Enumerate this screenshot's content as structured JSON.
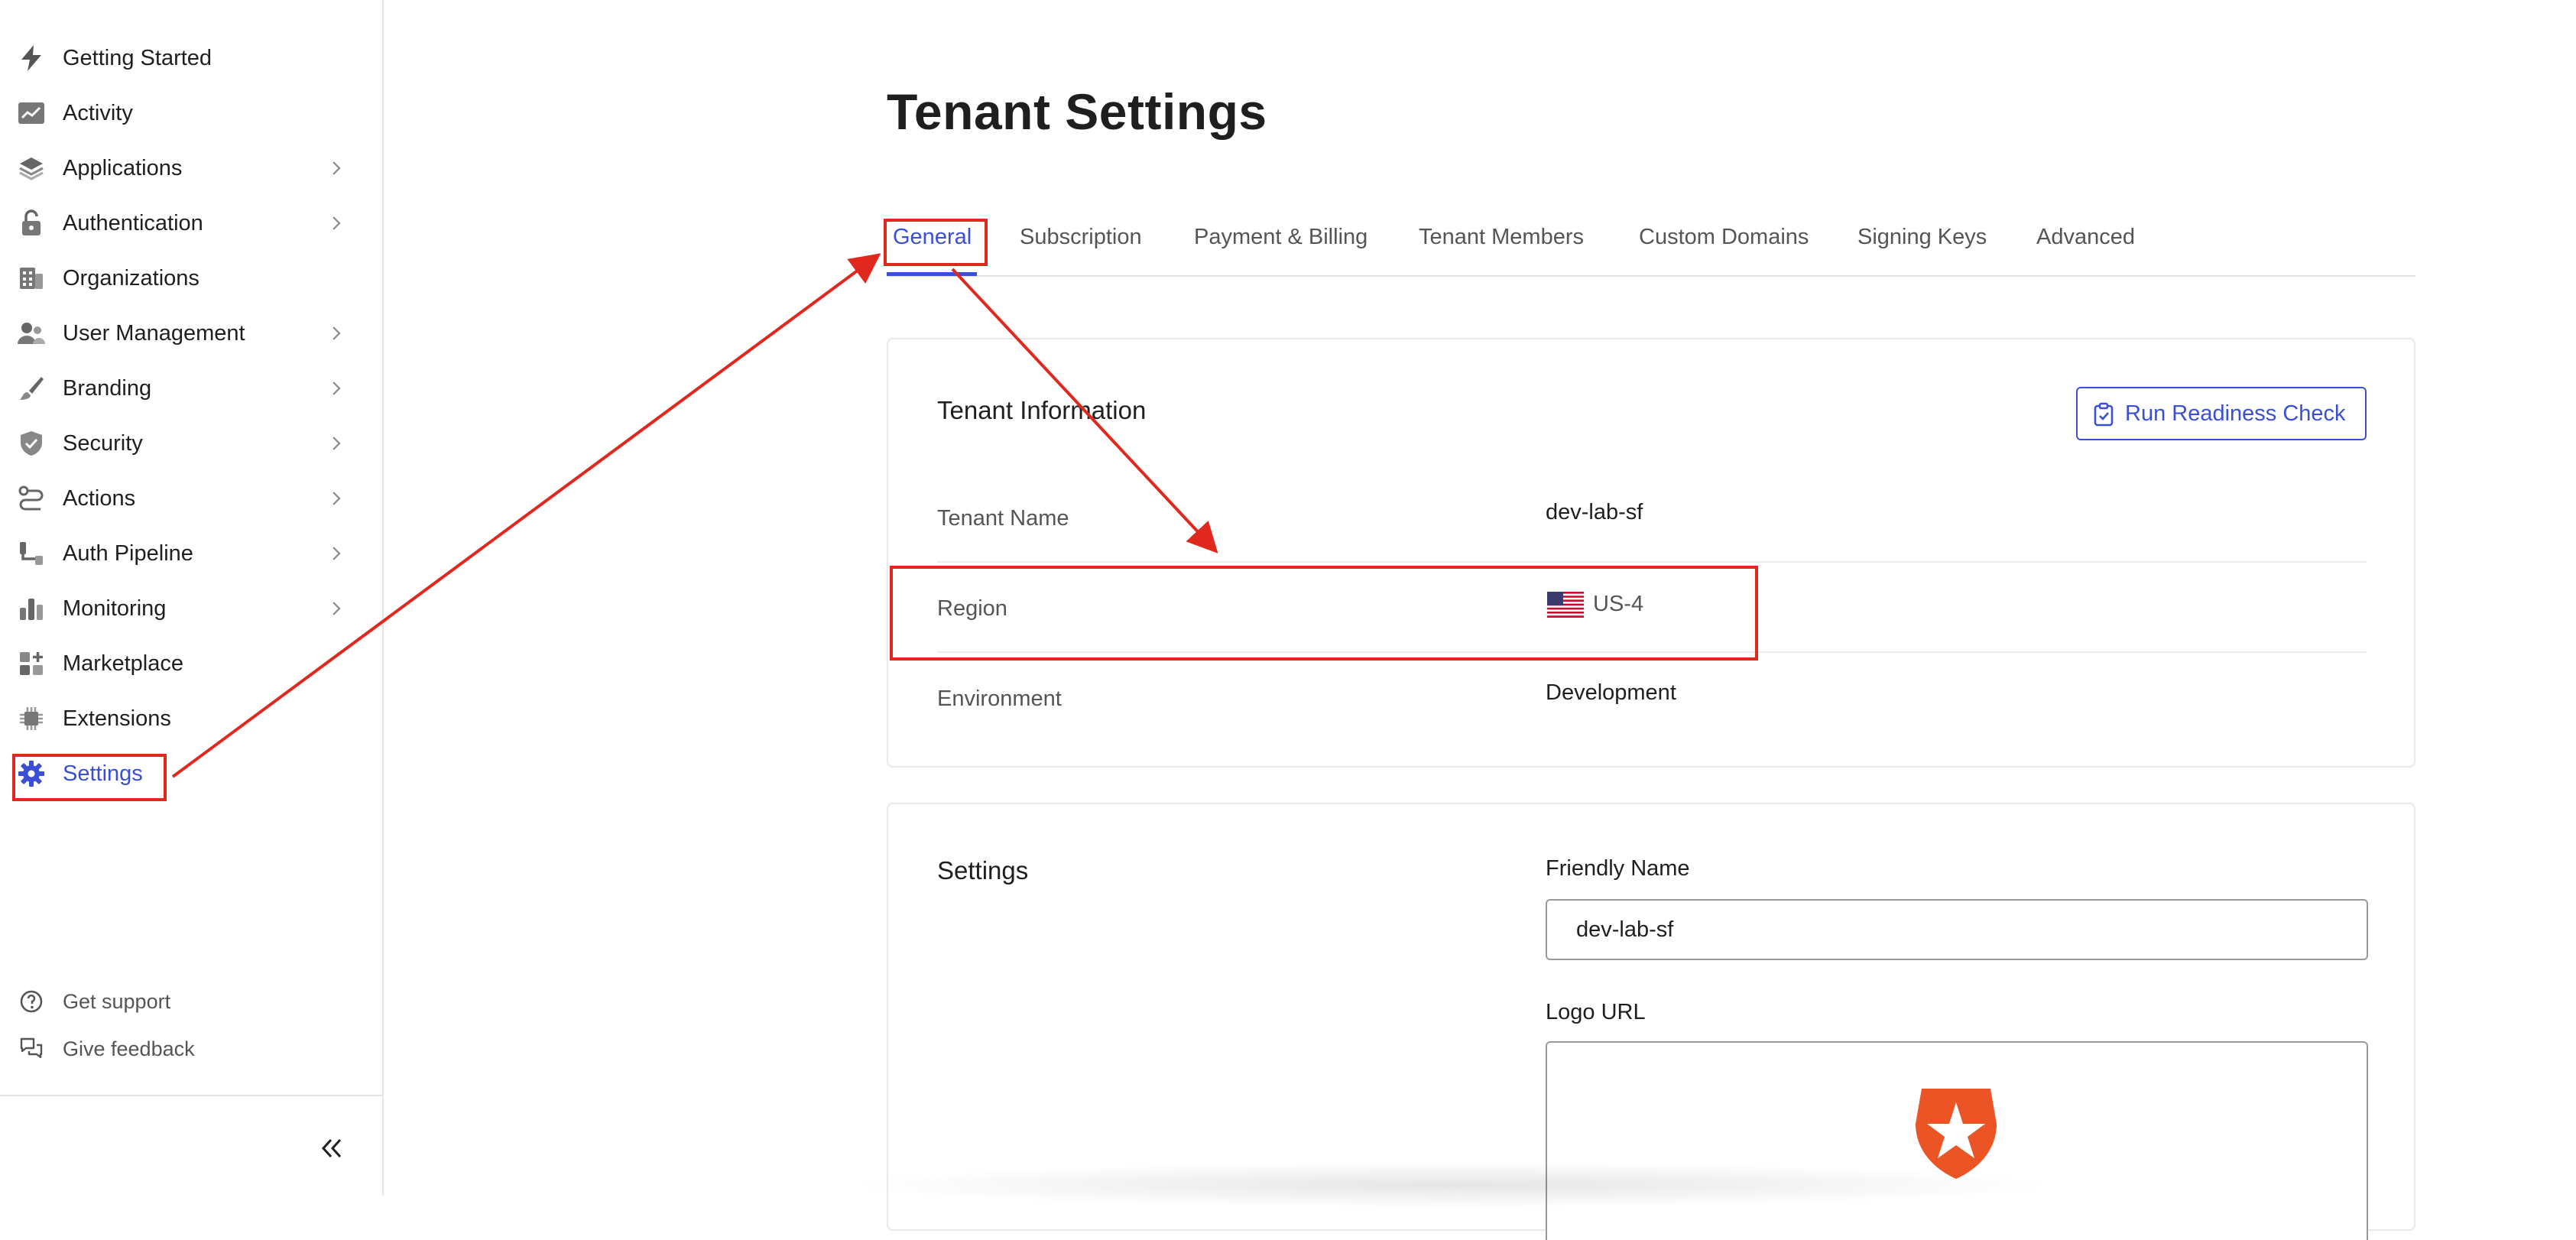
{
  "sidebar": {
    "items": [
      {
        "label": "Getting Started",
        "icon": "bolt-icon"
      },
      {
        "label": "Activity",
        "icon": "activity-chart-icon"
      },
      {
        "label": "Applications",
        "icon": "layers-icon"
      },
      {
        "label": "Authentication",
        "icon": "lock-icon"
      },
      {
        "label": "Organizations",
        "icon": "building-icon"
      },
      {
        "label": "User Management",
        "icon": "users-icon"
      },
      {
        "label": "Branding",
        "icon": "brush-icon"
      },
      {
        "label": "Security",
        "icon": "shield-check-icon"
      },
      {
        "label": "Actions",
        "icon": "flow-icon"
      },
      {
        "label": "Auth Pipeline",
        "icon": "pipeline-icon"
      },
      {
        "label": "Monitoring",
        "icon": "bar-chart-icon"
      },
      {
        "label": "Marketplace",
        "icon": "grid-plus-icon"
      },
      {
        "label": "Extensions",
        "icon": "chip-icon"
      },
      {
        "label": "Settings",
        "icon": "gear-icon"
      }
    ],
    "footer": {
      "support_label": "Get support",
      "feedback_label": "Give feedback"
    }
  },
  "page": {
    "title": "Tenant Settings",
    "tabs": [
      {
        "label": "General"
      },
      {
        "label": "Subscription"
      },
      {
        "label": "Payment & Billing"
      },
      {
        "label": "Tenant Members"
      },
      {
        "label": "Custom Domains"
      },
      {
        "label": "Signing Keys"
      },
      {
        "label": "Advanced"
      }
    ],
    "active_tab": "General"
  },
  "tenant_info": {
    "title": "Tenant Information",
    "readiness_button_label": "Run Readiness Check",
    "rows": [
      {
        "label": "Tenant Name",
        "value": "dev-lab-sf"
      },
      {
        "label": "Region",
        "value": "US-4"
      },
      {
        "label": "Environment",
        "value": "Development"
      }
    ]
  },
  "settings": {
    "title": "Settings",
    "friendly_name_label": "Friendly Name",
    "friendly_name_value": "dev-lab-sf",
    "logo_url_label": "Logo URL"
  },
  "colors": {
    "accent": "#3b4fd6",
    "annotation": "#e0281e",
    "logo_red": "#eb5424"
  }
}
